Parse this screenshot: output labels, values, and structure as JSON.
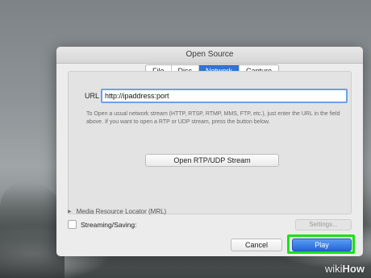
{
  "dialog": {
    "title": "Open Source",
    "tabs": [
      {
        "label": "File",
        "active": false
      },
      {
        "label": "Disc",
        "active": false
      },
      {
        "label": "Network",
        "active": true
      },
      {
        "label": "Capture",
        "active": false
      }
    ]
  },
  "network": {
    "url_label": "URL",
    "url_value": "http://ipaddress:port",
    "help_text": "To Open a usual network stream (HTTP, RTSP, RTMP, MMS, FTP, etc.), just enter the URL in the field above. If you want to open a RTP or UDP stream, press the button below.",
    "rtp_button": "Open RTP/UDP Stream"
  },
  "footer": {
    "mrl_label": "Media Resource Locator (MRL)",
    "streaming_label": "Streaming/Saving:",
    "settings_button": "Settings...",
    "cancel_button": "Cancel",
    "play_button": "Play"
  },
  "watermark": {
    "prefix": "wiki",
    "suffix": "How"
  },
  "colors": {
    "accent": "#2f74d8",
    "highlight": "#19e119"
  }
}
